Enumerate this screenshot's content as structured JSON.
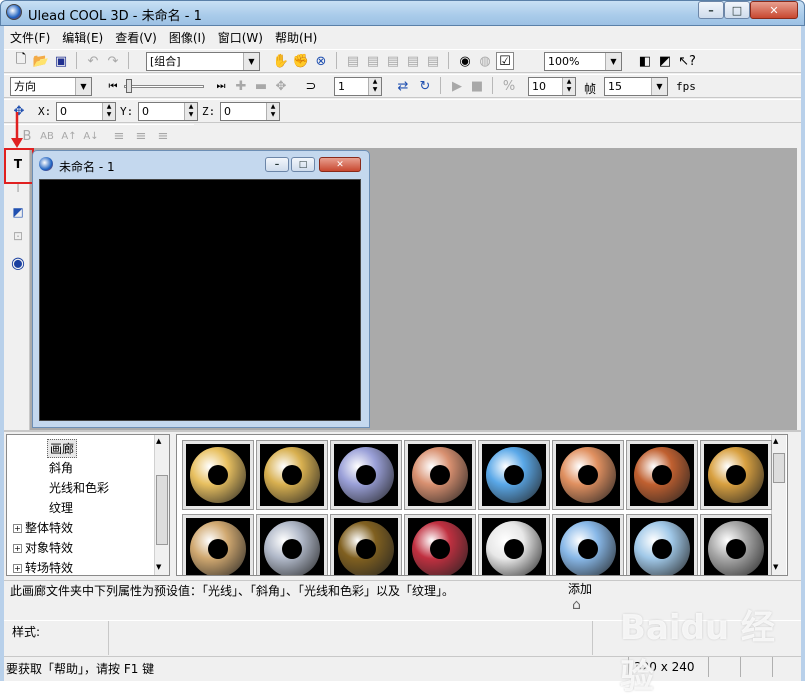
{
  "app": {
    "title": "Ulead COOL 3D - 未命名 - 1"
  },
  "menu": [
    "文件(F)",
    "编辑(E)",
    "查看(V)",
    "图像(I)",
    "窗口(W)",
    "帮助(H)"
  ],
  "toolbar1": {
    "object_combo": "[组合]",
    "zoom_combo": "100%"
  },
  "toolbar2": {
    "direction_combo": "方向",
    "frame_value": "1",
    "speed_value": "10",
    "frame_label": "帧",
    "fps_value": "15",
    "fps_label": "fps"
  },
  "toolbar3": {
    "x_label": "X:",
    "x_value": "0",
    "y_label": "Y:",
    "y_value": "0",
    "z_label": "Z:",
    "z_value": "0"
  },
  "document": {
    "title": "未命名 - 1"
  },
  "tree": {
    "items": [
      {
        "label": "画廊",
        "expandable": false
      },
      {
        "label": "斜角",
        "expandable": false
      },
      {
        "label": "光线和色彩",
        "expandable": false
      },
      {
        "label": "纹理",
        "expandable": false
      },
      {
        "label": "整体特效",
        "expandable": true
      },
      {
        "label": "对象特效",
        "expandable": true
      },
      {
        "label": "转场特效",
        "expandable": true
      }
    ]
  },
  "thumbnails": [
    {
      "color": "#e8c060"
    },
    {
      "color": "#d8b050"
    },
    {
      "color": "#9aa0d8"
    },
    {
      "color": "#d89070"
    },
    {
      "color": "#5aa8e8"
    },
    {
      "color": "#e09060"
    },
    {
      "color": "#c06030"
    },
    {
      "color": "#d8a040"
    },
    {
      "color": "#d0a870"
    },
    {
      "color": "#b0b8c8"
    },
    {
      "color": "#806020"
    },
    {
      "color": "#c03040"
    },
    {
      "color": "#e8e8e8"
    },
    {
      "color": "#88b8e8"
    },
    {
      "color": "#a0c8e8"
    },
    {
      "color": "#a8a8a8"
    }
  ],
  "description": {
    "text": "此画廊文件夹中下列属性为预设值：「光线」、「斜角」、「光线和色彩」以及「纹理」。"
  },
  "add_label": "添加",
  "style_label": "样式:",
  "status": {
    "help": "要获取「帮助」，请按 F1 键",
    "size": "320 x 240"
  },
  "watermark": "Baidu 经验"
}
